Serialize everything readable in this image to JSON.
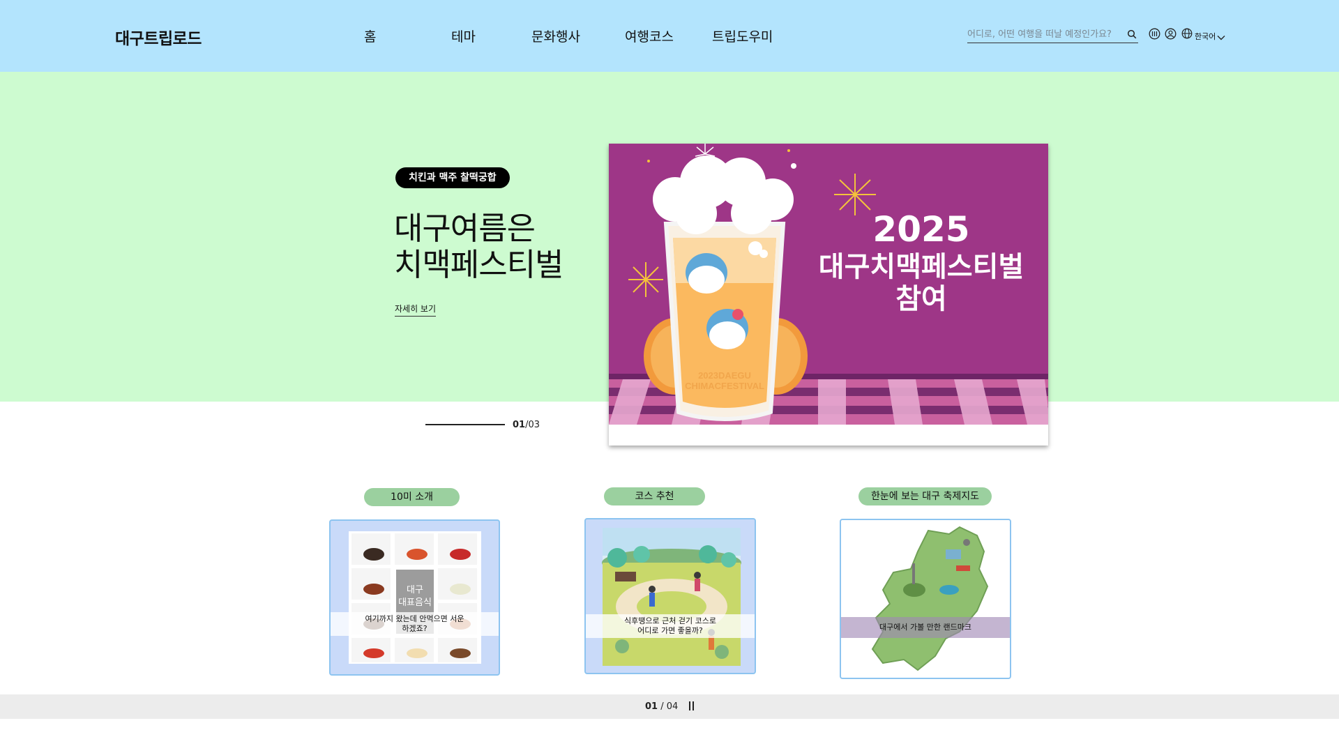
{
  "header": {
    "logo": "대구트립로드",
    "nav": [
      "홈",
      "테마",
      "문화행사",
      "여행코스",
      "트립도우미"
    ],
    "search_placeholder": "어디로, 어떤 여행을 떠날 예정인가요?",
    "language": "한국어"
  },
  "hero": {
    "badge": "치킨과 맥주 찰떡궁합",
    "title_line1": "대구여름은",
    "title_line2": "치맥페스티벌",
    "more_link": "자세히 보기",
    "counter_current": "01",
    "counter_total": "/03",
    "poster": {
      "title_line1": "2025",
      "title_line2": "대구치맥페스티벌",
      "title_line3": "참여",
      "glass_text_line1": "2023DAEGU",
      "glass_text_line2": "CHIMACFESTIVAL",
      "bg_color": "#9e3687"
    }
  },
  "cards": [
    {
      "tag": "10미 소개",
      "caption_line1": "여기까지 왔는데 안먹으면 서운",
      "caption_line2": "하겠죠?",
      "center_label_line1": "대구",
      "center_label_line2": "대표음식"
    },
    {
      "tag": "코스 추천",
      "caption_line1": "식후땡으로 근처 걷기 코스로",
      "caption_line2": "어디로 가면 좋을까?"
    },
    {
      "tag": "한눈에 보는 대구 축제지도",
      "caption_line1": "대구에서 가볼 만한 랜드마크"
    }
  ],
  "bottom": {
    "counter_current": "01",
    "counter_total": " / 04"
  },
  "colors": {
    "header_bg": "#b3e4fd",
    "hero_bg": "#cdfbd0",
    "tag_bg": "#9bd09f",
    "card_border": "#8dc4f0"
  }
}
